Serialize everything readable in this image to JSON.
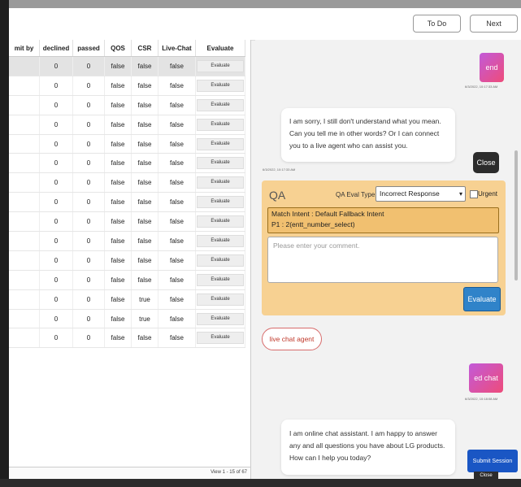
{
  "header": {
    "todo_label": "To Do",
    "next_label": "Next"
  },
  "table": {
    "columns": [
      "mit by",
      "declined",
      "passed",
      "QOS",
      "CSR",
      "Live-Chat",
      "Evaluate"
    ],
    "rows": [
      {
        "by": "",
        "declined": "0",
        "passed": "0",
        "qos": "false",
        "csr": "false",
        "live": "false",
        "evaluate": "Evaluate"
      },
      {
        "by": "",
        "declined": "0",
        "passed": "0",
        "qos": "false",
        "csr": "false",
        "live": "false",
        "evaluate": "Evaluate"
      },
      {
        "by": "",
        "declined": "0",
        "passed": "0",
        "qos": "false",
        "csr": "false",
        "live": "false",
        "evaluate": "Evaluate"
      },
      {
        "by": "",
        "declined": "0",
        "passed": "0",
        "qos": "false",
        "csr": "false",
        "live": "false",
        "evaluate": "Evaluate"
      },
      {
        "by": "",
        "declined": "0",
        "passed": "0",
        "qos": "false",
        "csr": "false",
        "live": "false",
        "evaluate": "Evaluate"
      },
      {
        "by": "",
        "declined": "0",
        "passed": "0",
        "qos": "false",
        "csr": "false",
        "live": "false",
        "evaluate": "Evaluate"
      },
      {
        "by": "",
        "declined": "0",
        "passed": "0",
        "qos": "false",
        "csr": "false",
        "live": "false",
        "evaluate": "Evaluate"
      },
      {
        "by": "",
        "declined": "0",
        "passed": "0",
        "qos": "false",
        "csr": "false",
        "live": "false",
        "evaluate": "Evaluate"
      },
      {
        "by": "",
        "declined": "0",
        "passed": "0",
        "qos": "false",
        "csr": "false",
        "live": "false",
        "evaluate": "Evaluate"
      },
      {
        "by": "",
        "declined": "0",
        "passed": "0",
        "qos": "false",
        "csr": "false",
        "live": "false",
        "evaluate": "Evaluate"
      },
      {
        "by": "",
        "declined": "0",
        "passed": "0",
        "qos": "false",
        "csr": "false",
        "live": "false",
        "evaluate": "Evaluate"
      },
      {
        "by": "",
        "declined": "0",
        "passed": "0",
        "qos": "false",
        "csr": "false",
        "live": "false",
        "evaluate": "Evaluate"
      },
      {
        "by": "",
        "declined": "0",
        "passed": "0",
        "qos": "false",
        "csr": "true",
        "live": "false",
        "evaluate": "Evaluate"
      },
      {
        "by": "",
        "declined": "0",
        "passed": "0",
        "qos": "false",
        "csr": "true",
        "live": "false",
        "evaluate": "Evaluate"
      },
      {
        "by": "",
        "declined": "0",
        "passed": "0",
        "qos": "false",
        "csr": "false",
        "live": "false",
        "evaluate": "Evaluate"
      }
    ],
    "pager_text": "View 1 - 15 of 67"
  },
  "chat": {
    "user_avatar_label": "end",
    "user_ts": "6/3/2022, 10:17:33 AM",
    "bot_message": "I am sorry, I still don't understand what you mean. Can you tell me in other words? Or I can connect you to a live agent who can assist you.",
    "bot_ts": "6/3/2022, 10:17:33 AM",
    "close_label": "Close",
    "qa": {
      "title": "QA",
      "eval_type_label": "QA Eval Type",
      "eval_type_value": "Incorrect Response",
      "urgent_label": "Urgent",
      "intent_line1": "Match Intent : Default Fallback Intent",
      "intent_line2": "P1 : 2(entt_number_select)",
      "comment_placeholder": "Please enter your comment.",
      "evaluate_label": "Evaluate"
    },
    "live_chat_chip": "live chat agent",
    "user2_avatar_label": "ed chat",
    "user2_ts": "6/3/2022, 10:18:08 AM",
    "bot2_message": "I am online chat assistant. I am happy to answer any and all questions you have about LG products. How can I help you today?",
    "submit_label": "Submit Session",
    "close2_label": "Close"
  }
}
